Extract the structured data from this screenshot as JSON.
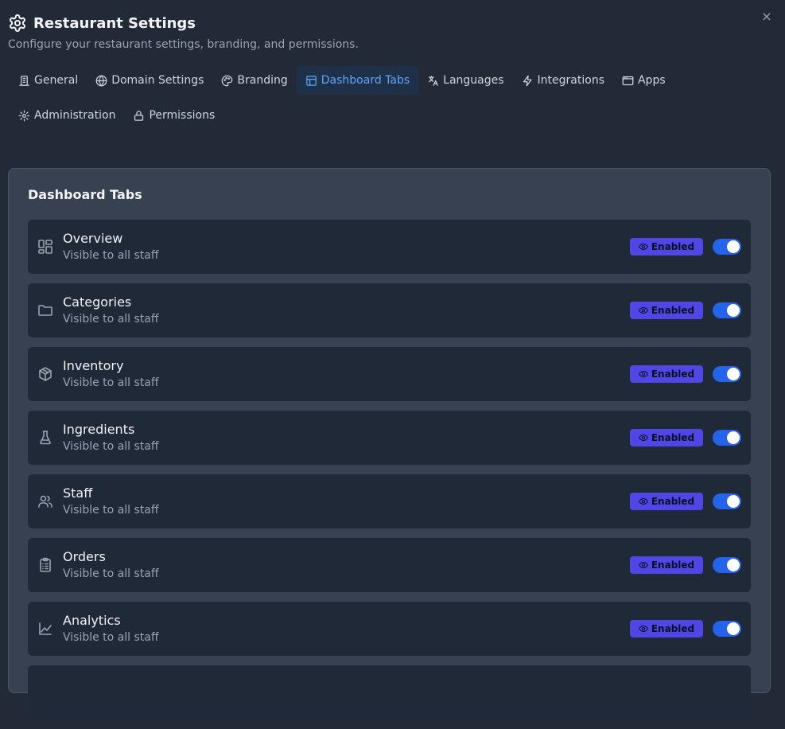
{
  "header": {
    "title": "Restaurant Settings",
    "subtitle": "Configure your restaurant settings, branding, and permissions.",
    "close_label": "×"
  },
  "tabs": [
    {
      "label": "General",
      "icon": "building-icon"
    },
    {
      "label": "Domain Settings",
      "icon": "globe-icon"
    },
    {
      "label": "Branding",
      "icon": "palette-icon"
    },
    {
      "label": "Dashboard Tabs",
      "icon": "layout-icon",
      "active": true
    },
    {
      "label": "Languages",
      "icon": "translate-icon"
    },
    {
      "label": "Integrations",
      "icon": "zap-icon"
    },
    {
      "label": "Apps",
      "icon": "app-window-icon"
    },
    {
      "label": "Administration",
      "icon": "gear-icon"
    },
    {
      "label": "Permissions",
      "icon": "lock-icon"
    }
  ],
  "panel": {
    "title": "Dashboard Tabs",
    "items": [
      {
        "name": "Overview",
        "desc": "Visible to all staff",
        "status": "Enabled",
        "icon": "grid-icon",
        "enabled": true
      },
      {
        "name": "Categories",
        "desc": "Visible to all staff",
        "status": "Enabled",
        "icon": "folder-icon",
        "enabled": true
      },
      {
        "name": "Inventory",
        "desc": "Visible to all staff",
        "status": "Enabled",
        "icon": "package-icon",
        "enabled": true
      },
      {
        "name": "Ingredients",
        "desc": "Visible to all staff",
        "status": "Enabled",
        "icon": "flask-icon",
        "enabled": true
      },
      {
        "name": "Staff",
        "desc": "Visible to all staff",
        "status": "Enabled",
        "icon": "users-icon",
        "enabled": true
      },
      {
        "name": "Orders",
        "desc": "Visible to all staff",
        "status": "Enabled",
        "icon": "clipboard-icon",
        "enabled": true
      },
      {
        "name": "Analytics",
        "desc": "Visible to all staff",
        "status": "Enabled",
        "icon": "chart-line-icon",
        "enabled": true
      }
    ]
  },
  "colors": {
    "background": "#222a38",
    "panel": "#374151",
    "card": "#1f2937",
    "accent": "#60a5fa",
    "badge": "#4f46e5",
    "toggle_on": "#2563eb"
  }
}
